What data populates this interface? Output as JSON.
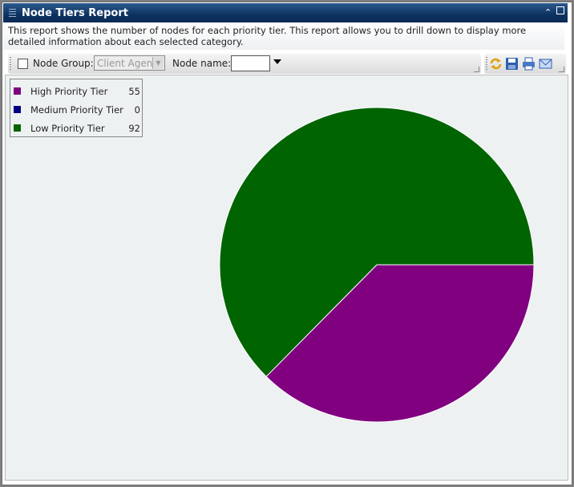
{
  "window": {
    "title": "Node Tiers Report",
    "collapse_icon": "double-chevron-up-icon",
    "maximize_icon": "square-icon"
  },
  "description": "This report shows the number of nodes for each priority tier. This report allows you to drill down to display more detailed information about each selected category.",
  "toolbar": {
    "node_group_checked": false,
    "node_group_label": "Node Group:",
    "node_group_value": "Client Agent",
    "node_name_label": "Node name:",
    "node_name_value": "",
    "actions": [
      "refresh-icon",
      "save-icon",
      "print-icon",
      "email-icon"
    ]
  },
  "chart_data": {
    "type": "pie",
    "title": "",
    "categories": [
      "High Priority Tier",
      "Medium Priority Tier",
      "Low Priority Tier"
    ],
    "values": [
      55,
      0,
      92
    ],
    "colors": [
      "#800080",
      "#000080",
      "#006400"
    ],
    "legend_position": "top-left",
    "start_angle": "3 o'clock, clockwise"
  }
}
